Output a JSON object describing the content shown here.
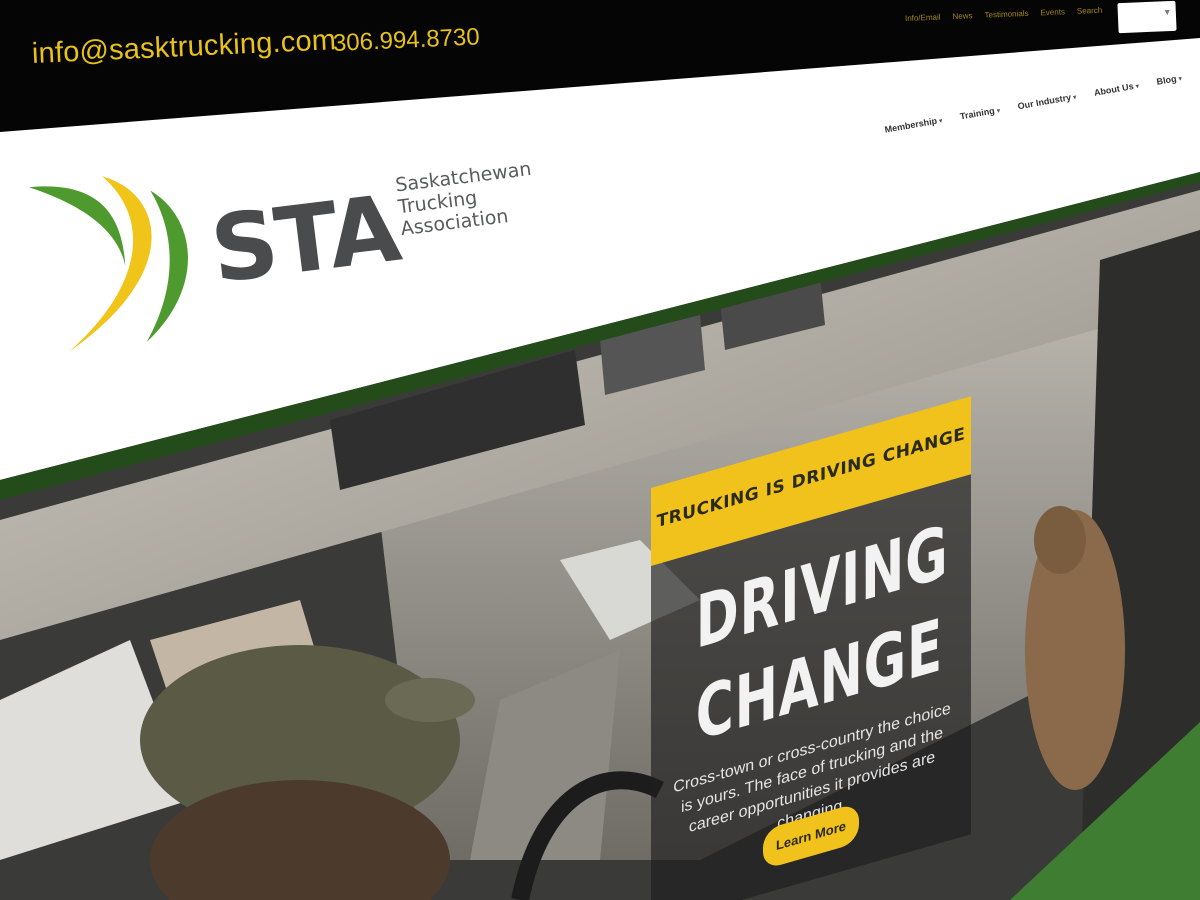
{
  "topbar": {
    "email": "info@sasktrucking.com",
    "phone": "306.994.8730",
    "util_links": [
      "Info/Email",
      "News",
      "Testimonials",
      "Events",
      "Search"
    ]
  },
  "logo": {
    "acronym": "STA",
    "name_lines": [
      "Saskatchewan",
      "Trucking",
      "Association"
    ],
    "colors": {
      "green": "#4f9a2e",
      "yellow": "#f0c419",
      "gray": "#4a4b4c"
    }
  },
  "nav": {
    "items": [
      "Membership",
      "Training",
      "Our Industry",
      "About Us",
      "Blog"
    ]
  },
  "hero": {
    "tagline": "TRUCKING IS DRIVING CHANGE",
    "title_line1": "DRIVING",
    "title_line2": "CHANGE",
    "body": "Cross-town or cross-country the choice is yours. The face of trucking and the career opportunities it provides are changing.",
    "cta": "Learn More"
  },
  "colors": {
    "accent_yellow": "#f1c21b",
    "accent_green": "#3f7d32",
    "header_line": "#244c1a"
  }
}
